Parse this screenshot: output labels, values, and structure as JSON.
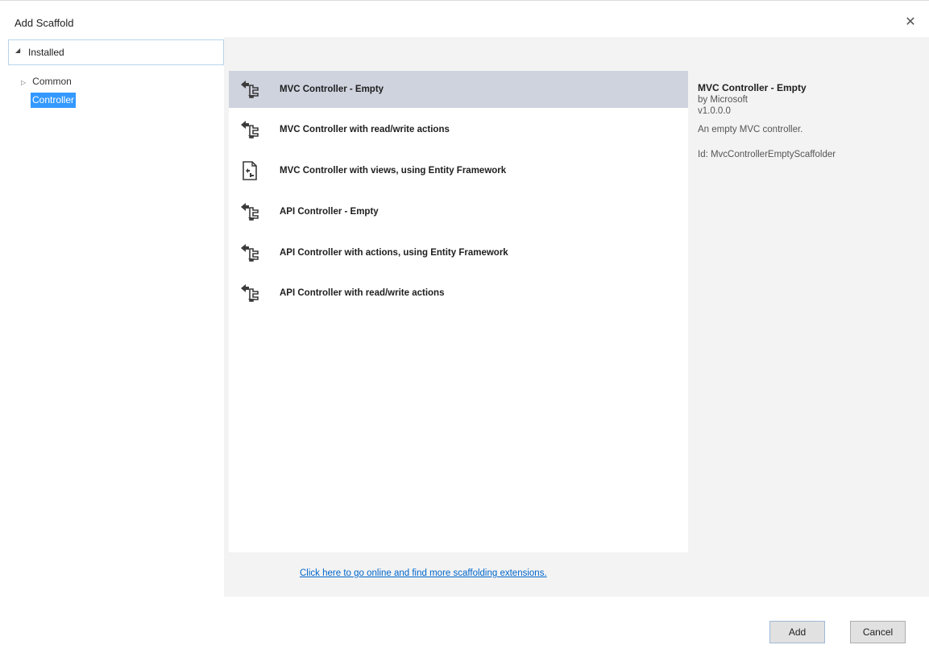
{
  "window": {
    "title": "Add Scaffold",
    "close_glyph": "✕"
  },
  "tree": {
    "installed_label": "Installed",
    "installed_arrow": "◢",
    "items": [
      {
        "label": "Common",
        "expander": "▷"
      },
      {
        "label": "Controller",
        "selected": true
      }
    ]
  },
  "templates": [
    {
      "label": "MVC Controller - Empty",
      "icon": "controller-icon",
      "selected": true
    },
    {
      "label": "MVC Controller with read/write actions",
      "icon": "controller-icon"
    },
    {
      "label": "MVC Controller with views, using Entity Framework",
      "icon": "document-icon"
    },
    {
      "label": "API Controller - Empty",
      "icon": "controller-icon"
    },
    {
      "label": "API Controller with actions, using Entity Framework",
      "icon": "controller-icon"
    },
    {
      "label": "API Controller with read/write actions",
      "icon": "controller-icon"
    }
  ],
  "details": {
    "title": "MVC Controller - Empty",
    "author": "by Microsoft",
    "version": "v1.0.0.0",
    "description": "An empty MVC controller.",
    "id": "Id: MvcControllerEmptyScaffolder"
  },
  "online_link": "Click here to go online and find more scaffolding extensions.",
  "buttons": {
    "add": "Add",
    "cancel": "Cancel"
  }
}
